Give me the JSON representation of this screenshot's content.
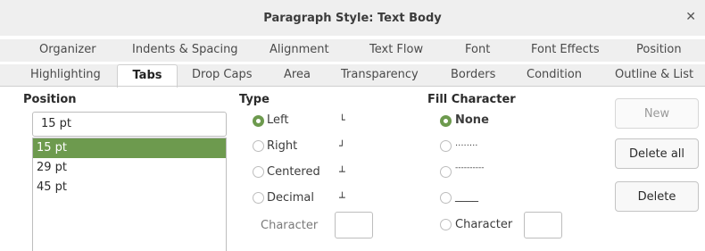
{
  "window": {
    "title": "Paragraph Style: Text Body"
  },
  "tabs": {
    "row1": [
      "Organizer",
      "Indents & Spacing",
      "Alignment",
      "Text Flow",
      "Font",
      "Font Effects",
      "Position"
    ],
    "row2": [
      "Highlighting",
      "Tabs",
      "Drop Caps",
      "Area",
      "Transparency",
      "Borders",
      "Condition",
      "Outline & List"
    ],
    "active": "Tabs"
  },
  "position": {
    "heading": "Position",
    "input_value": "15 pt",
    "items": [
      "15 pt",
      "29 pt",
      "45 pt"
    ],
    "selected": "15 pt"
  },
  "type": {
    "heading": "Type",
    "options": [
      "Left",
      "Right",
      "Centered",
      "Decimal"
    ],
    "selected": "Left",
    "character_label": "Character",
    "character_value": ""
  },
  "fill": {
    "heading": "Fill Character",
    "options": [
      "None",
      "........",
      "----------",
      "____",
      "Character"
    ],
    "selected": "None",
    "character_value": ""
  },
  "buttons": {
    "new": "New",
    "delete_all": "Delete all",
    "delete": "Delete"
  },
  "colors": {
    "accent": "#6d9a4e"
  }
}
